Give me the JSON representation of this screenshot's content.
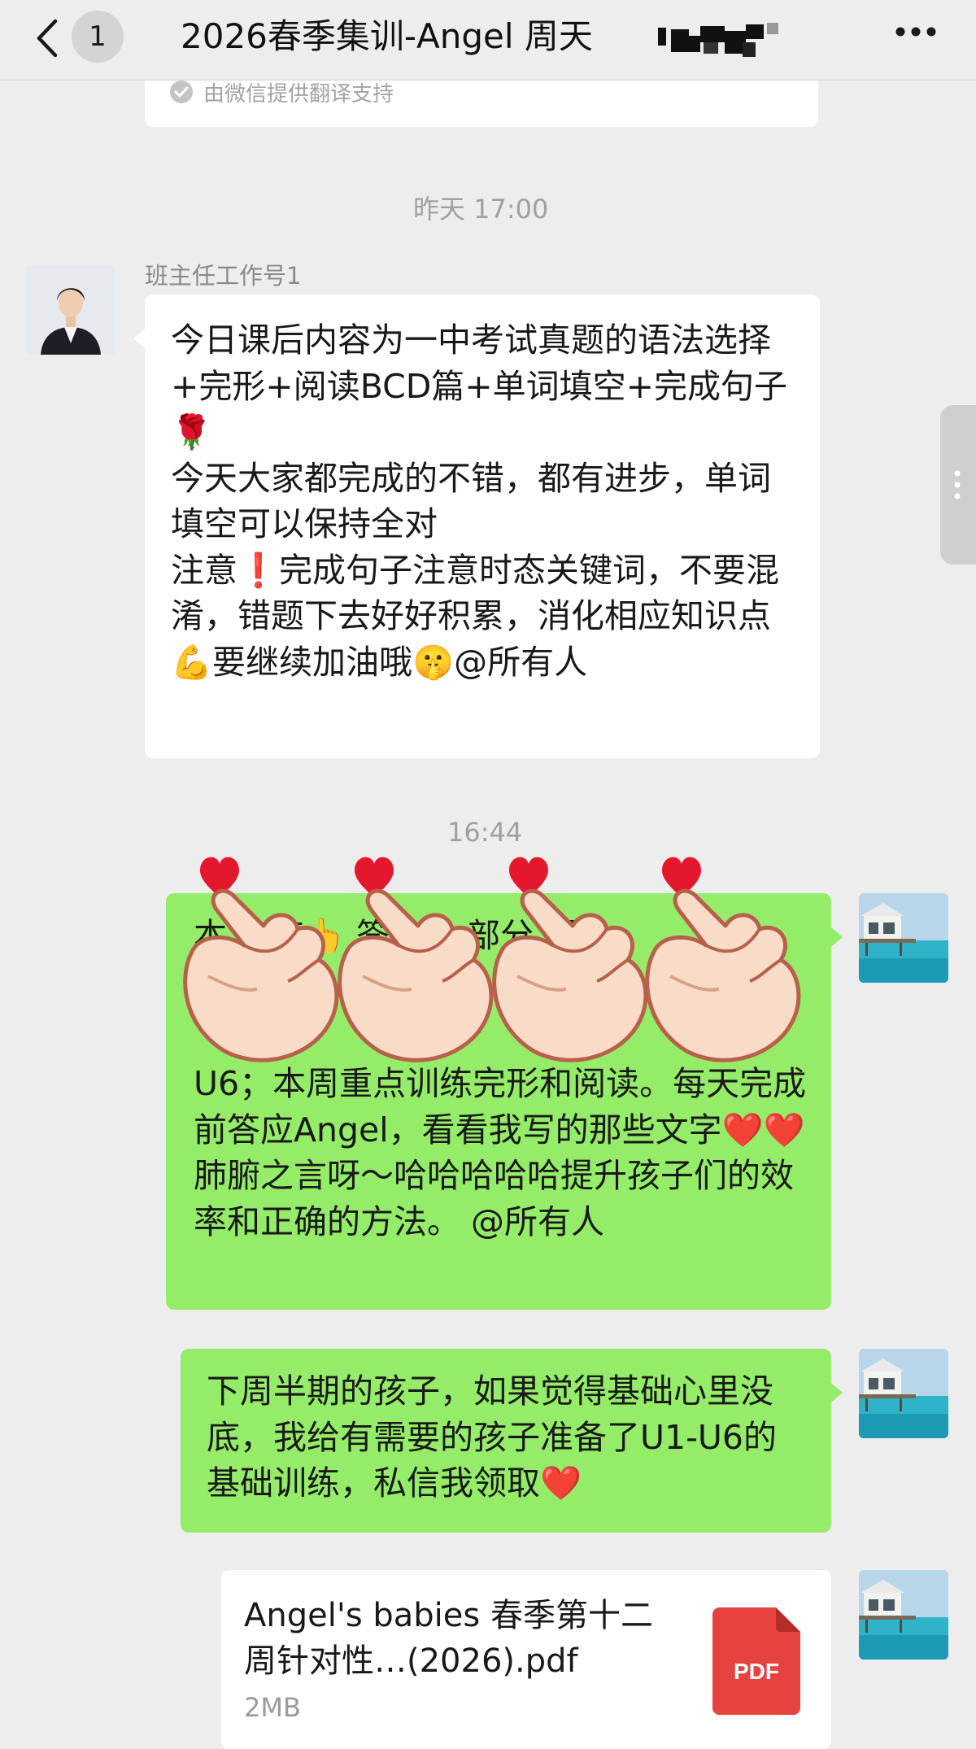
{
  "header": {
    "back_badge": "1",
    "title": "2026春季集训-Angel 周天"
  },
  "translation_note": "由微信提供翻译支持",
  "timestamps": {
    "first": "昨天 17:00",
    "second": "16:44"
  },
  "messages": [
    {
      "sender": "班主任工作号1",
      "side": "left",
      "text": "今日课后内容为一中考试真题的语法选择+完形+阅读BCD篇+单词填空+完成句子🌹\n今天大家都完成的不错，都有进步，单词填空可以保持全对\n注意❗完成句子注意时态关键词，不要混淆，错题下去好好积累，消化相应知识点💪要继续加油哦🤫@所有人"
    },
    {
      "side": "right",
      "text_line1": "本    训练👆    签收～    部分    通",
      "text_rest": "U6；本周重点训练完形和阅读。每天完成前答应Angel，看看我写的那些文字❤️❤️肺腑之言呀～哈哈哈哈哈提升孩子们的效率和正确的方法。 @所有人"
    },
    {
      "side": "right",
      "text": "下周半期的孩子，如果觉得基础心里没底，我给有需要的孩子准备了U1-U6的基础训练，私信我领取❤️"
    },
    {
      "side": "right",
      "type": "file",
      "file_name": "Angel's babies 春季第十二周针对性…(2026).pdf",
      "file_size": "2MB",
      "file_badge": "PDF"
    }
  ],
  "colors": {
    "background": "#ededed",
    "bubble_self": "#95ec69",
    "bubble_other": "#ffffff",
    "pdf_red": "#e64340"
  }
}
